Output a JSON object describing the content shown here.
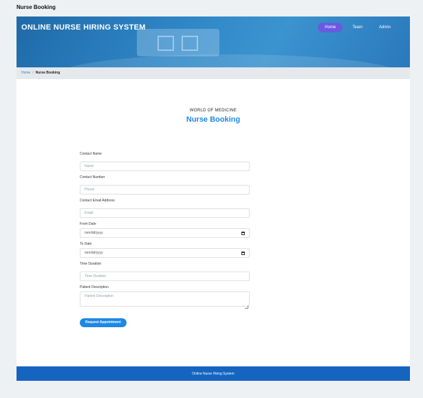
{
  "window": {
    "title": "Nurse Booking"
  },
  "header": {
    "brand": "ONLINE NURSE HIRING SYSTEM",
    "nav": [
      {
        "label": "Home",
        "active": true
      },
      {
        "label": "Team",
        "active": false
      },
      {
        "label": "Admin",
        "active": false
      }
    ]
  },
  "breadcrumb": {
    "home": "Home",
    "separator": "/",
    "current": "Nurse Booking"
  },
  "section": {
    "eyebrow": "WORLD OF MEDICINE",
    "title": "Nurse Booking"
  },
  "form": {
    "contact_name": {
      "label": "Contact Name",
      "placeholder": "Name"
    },
    "contact_number": {
      "label": "Contact Number",
      "placeholder": "Phone"
    },
    "email": {
      "label": "Contact Email Address",
      "placeholder": "Email"
    },
    "from_date": {
      "label": "From Date",
      "placeholder": "mm/dd/yyyy"
    },
    "to_date": {
      "label": "To Date",
      "placeholder": "mm/dd/yyyy"
    },
    "time_duration": {
      "label": "Time Duration",
      "placeholder": "Time Duration"
    },
    "patient_description": {
      "label": "Patient Description",
      "placeholder": "Patient Description"
    },
    "submit_label": "Request Appointment"
  },
  "footer": {
    "text": "Online Nurse Hiring System"
  },
  "colors": {
    "accent": "#1e88e5",
    "nav_active": "#6a5ae0",
    "footer": "#1565c0"
  },
  "icons": {
    "date": "calendar-icon",
    "textarea": "resize-handle-icon"
  }
}
